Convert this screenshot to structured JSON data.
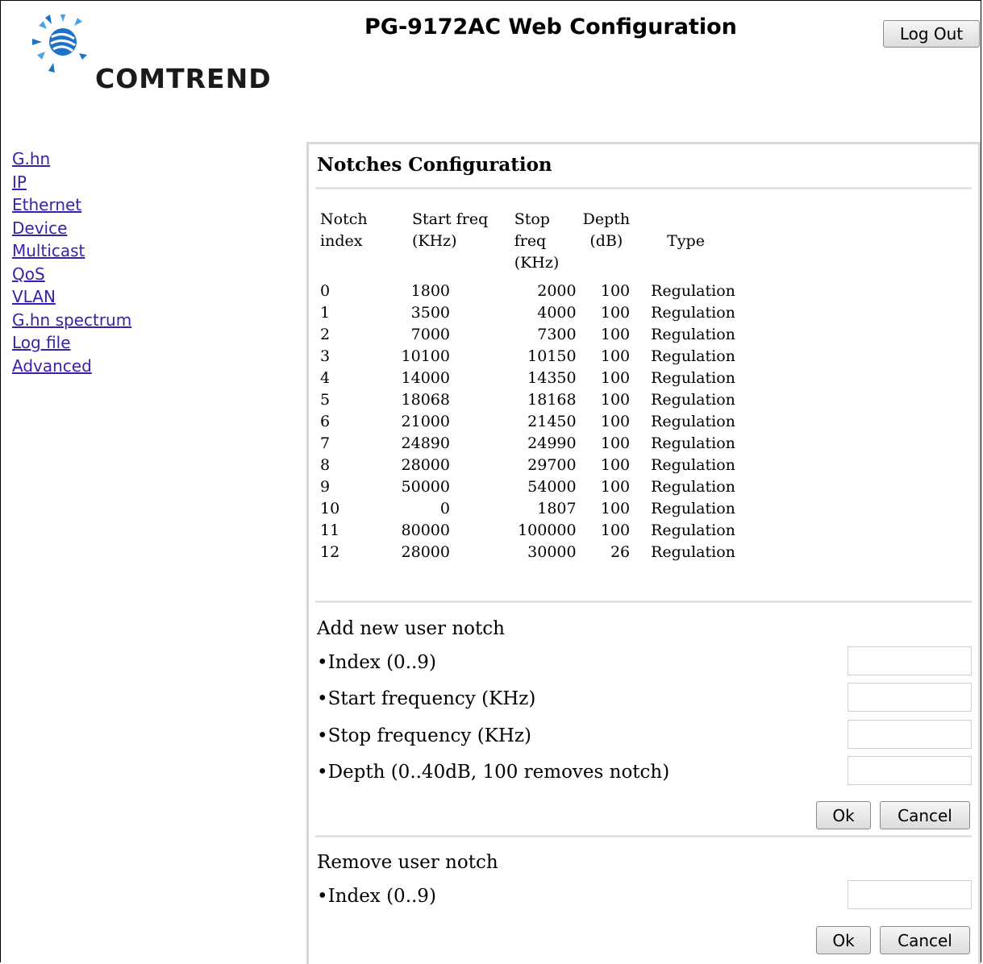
{
  "header": {
    "brand": "COMTREND",
    "title": "PG-9172AC Web Configuration",
    "logout_label": "Log Out"
  },
  "sidebar": {
    "items": [
      {
        "label": "G.hn"
      },
      {
        "label": "IP"
      },
      {
        "label": "Ethernet"
      },
      {
        "label": "Device"
      },
      {
        "label": "Multicast"
      },
      {
        "label": "QoS"
      },
      {
        "label": "VLAN"
      },
      {
        "label": "G.hn spectrum"
      },
      {
        "label": "Log file"
      },
      {
        "label": "Advanced"
      }
    ]
  },
  "notches": {
    "title": "Notches Configuration",
    "columns": [
      {
        "line1": "Notch",
        "line2": "index"
      },
      {
        "line1": "Start freq",
        "line2": "(KHz)"
      },
      {
        "line1": "Stop freq",
        "line2": "(KHz)"
      },
      {
        "line1": "Depth",
        "line2": "(dB)"
      },
      {
        "line1": "Type",
        "line2": ""
      }
    ],
    "rows": [
      [
        "0",
        "1800",
        "2000",
        "100",
        "Regulation"
      ],
      [
        "1",
        "3500",
        "4000",
        "100",
        "Regulation"
      ],
      [
        "2",
        "7000",
        "7300",
        "100",
        "Regulation"
      ],
      [
        "3",
        "10100",
        "10150",
        "100",
        "Regulation"
      ],
      [
        "4",
        "14000",
        "14350",
        "100",
        "Regulation"
      ],
      [
        "5",
        "18068",
        "18168",
        "100",
        "Regulation"
      ],
      [
        "6",
        "21000",
        "21450",
        "100",
        "Regulation"
      ],
      [
        "7",
        "24890",
        "24990",
        "100",
        "Regulation"
      ],
      [
        "8",
        "28000",
        "29700",
        "100",
        "Regulation"
      ],
      [
        "9",
        "50000",
        "54000",
        "100",
        "Regulation"
      ],
      [
        "10",
        "0",
        "1807",
        "100",
        "Regulation"
      ],
      [
        "11",
        "80000",
        "100000",
        "100",
        "Regulation"
      ],
      [
        "12",
        "28000",
        "30000",
        "26",
        "Regulation"
      ]
    ]
  },
  "add_notch": {
    "title": "Add new user notch",
    "index_label": "•Index (0..9)",
    "index_value": "",
    "start_label": "•Start frequency (KHz)",
    "start_value": "",
    "stop_label": "•Stop frequency (KHz)",
    "stop_value": "",
    "depth_label": "•Depth (0..40dB, 100 removes notch)",
    "depth_value": "",
    "ok_label": "Ok",
    "cancel_label": "Cancel"
  },
  "remove_notch": {
    "title": "Remove user notch",
    "index_label": "•Index (0..9)",
    "index_value": "",
    "ok_label": "Ok",
    "cancel_label": "Cancel"
  },
  "colors": {
    "link": "#3b1fa8",
    "panel_border": "#d8d8d8",
    "logo_blue": "#1e73c8",
    "logo_light_blue": "#4fa3e0"
  }
}
